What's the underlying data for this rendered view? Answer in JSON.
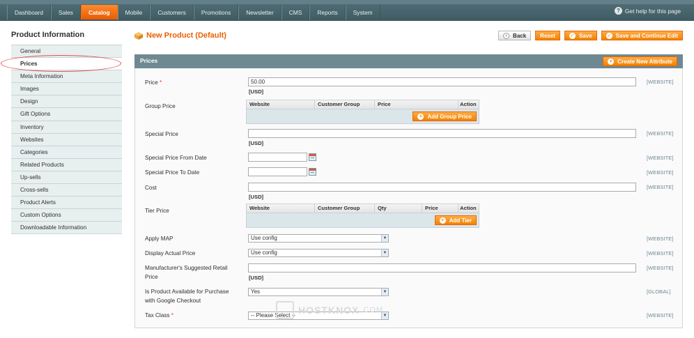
{
  "nav": {
    "items": [
      "Dashboard",
      "Sales",
      "Catalog",
      "Mobile",
      "Customers",
      "Promotions",
      "Newsletter",
      "CMS",
      "Reports",
      "System"
    ],
    "active": "Catalog",
    "help_text": "Get help for this page",
    "help_icon": "question-circle-icon"
  },
  "sidebar": {
    "title": "Product Information",
    "items": [
      "General",
      "Prices",
      "Meta Information",
      "Images",
      "Design",
      "Gift Options",
      "Inventory",
      "Websites",
      "Categories",
      "Related Products",
      "Up-sells",
      "Cross-sells",
      "Product Alerts",
      "Custom Options",
      "Downloadable Information"
    ],
    "active": "Prices"
  },
  "header": {
    "title": "New Product (Default)",
    "icon": "box-icon",
    "back": "Back",
    "reset": "Reset",
    "save": "Save",
    "save_continue": "Save and Continue Edit"
  },
  "section": {
    "title": "Prices",
    "create_attribute": "Create New Attribute"
  },
  "fields": {
    "price": {
      "label": "Price",
      "required": "*",
      "value": "50.00",
      "note": "[USD]",
      "scope": "[WEBSITE]"
    },
    "group_price": {
      "label": "Group Price",
      "columns": [
        "Website",
        "Customer Group",
        "Price",
        "Action"
      ],
      "button": "Add Group Price"
    },
    "special_price": {
      "label": "Special Price",
      "value": "",
      "note": "[USD]",
      "scope": "[WEBSITE]"
    },
    "special_from": {
      "label": "Special Price From Date",
      "value": "",
      "scope": "[WEBSITE]"
    },
    "special_to": {
      "label": "Special Price To Date",
      "value": "",
      "scope": "[WEBSITE]"
    },
    "cost": {
      "label": "Cost",
      "value": "",
      "note": "[USD]",
      "scope": "[WEBSITE]"
    },
    "tier_price": {
      "label": "Tier Price",
      "columns": [
        "Website",
        "Customer Group",
        "Qty",
        "Price",
        "Action"
      ],
      "button": "Add Tier"
    },
    "apply_map": {
      "label": "Apply MAP",
      "value": "Use config",
      "scope": "[WEBSITE]"
    },
    "display_actual": {
      "label": "Display Actual Price",
      "value": "Use config",
      "scope": "[WEBSITE]"
    },
    "msrp": {
      "label1": "Manufacturer's Suggested Retail",
      "label2": "Price",
      "value": "",
      "note": "[USD]",
      "scope": "[WEBSITE]"
    },
    "google_checkout": {
      "label1": "Is Product Available for Purchase",
      "label2": "with Google Checkout",
      "value": "Yes",
      "scope": "[GLOBAL]"
    },
    "tax_class": {
      "label": "Tax Class",
      "required": "*",
      "value": "-- Please Select --",
      "scope": "[WEBSITE]"
    }
  },
  "watermark": {
    "brand": "HOSTKNOX",
    "suffix": ".COM"
  },
  "colors": {
    "accent": "#eb5e00",
    "nav": "#4f6c74",
    "section_head": "#6f8992",
    "sidebar": "#e7efef"
  }
}
